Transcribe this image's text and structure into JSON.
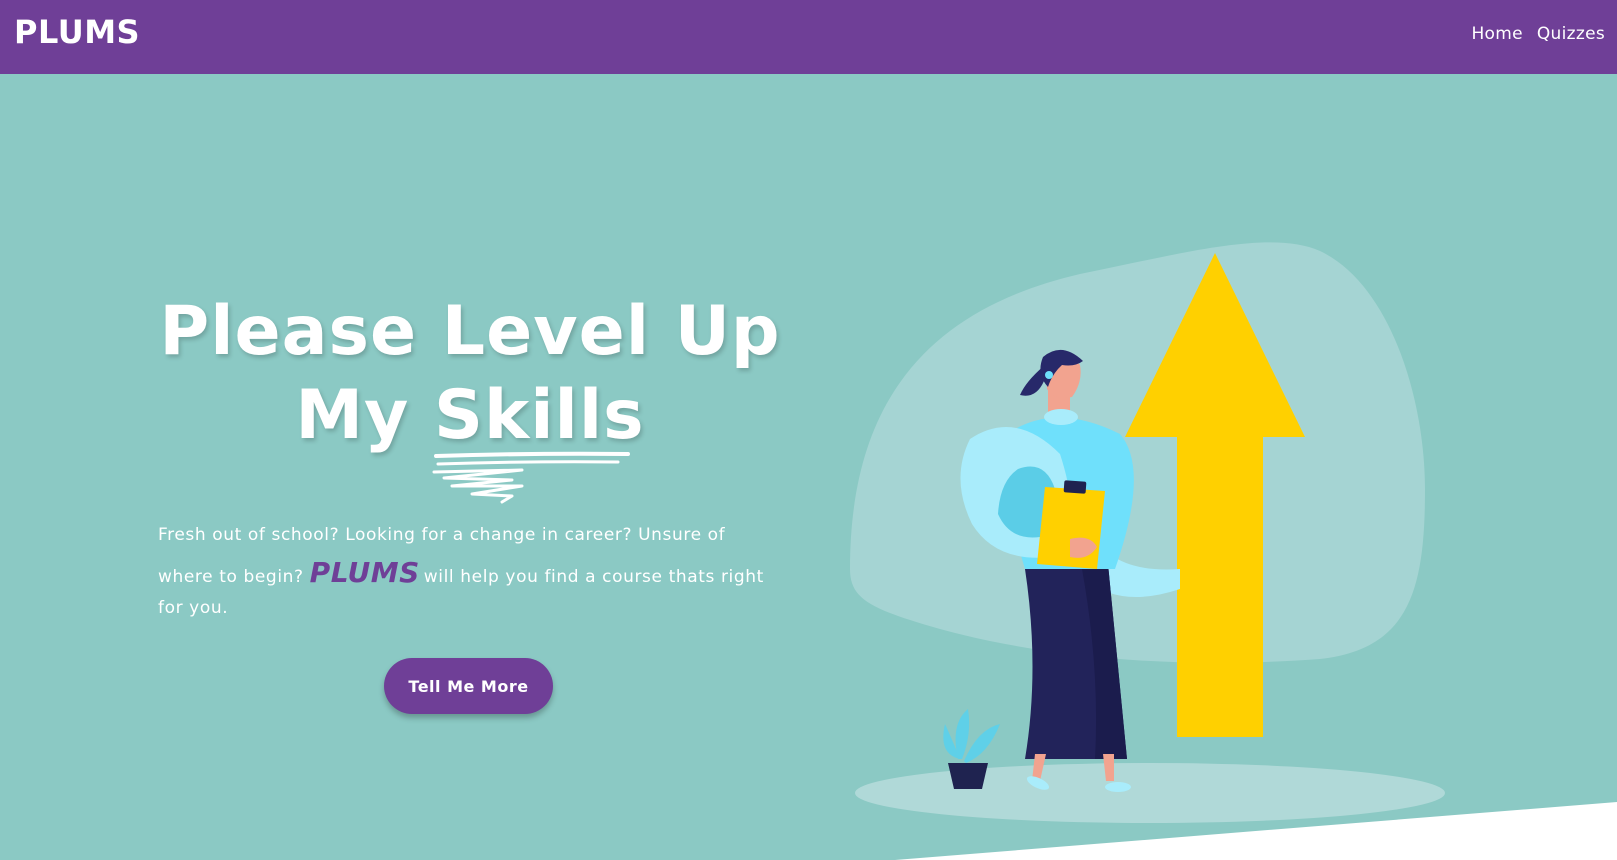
{
  "navbar": {
    "brand": "PLUMS",
    "links": [
      {
        "label": "Home"
      },
      {
        "label": "Quizzes"
      }
    ]
  },
  "hero": {
    "headline_line1": "Please Level Up",
    "headline_line2_prefix": "My ",
    "headline_line2_emphasis": "Skills",
    "tagline_part1": "Fresh out of school? Looking for a change in career? Unsure of",
    "tagline_part2_before": "where to begin?",
    "tagline_brand": "PLUMS",
    "tagline_part2_after": "will help you find a course thats right",
    "tagline_part3": "for you.",
    "cta_label": "Tell Me More"
  },
  "colors": {
    "primary_purple": "#6f3f97",
    "hero_teal": "#8bc9c4",
    "arrow_yellow": "#ffd000",
    "white": "#ffffff"
  }
}
